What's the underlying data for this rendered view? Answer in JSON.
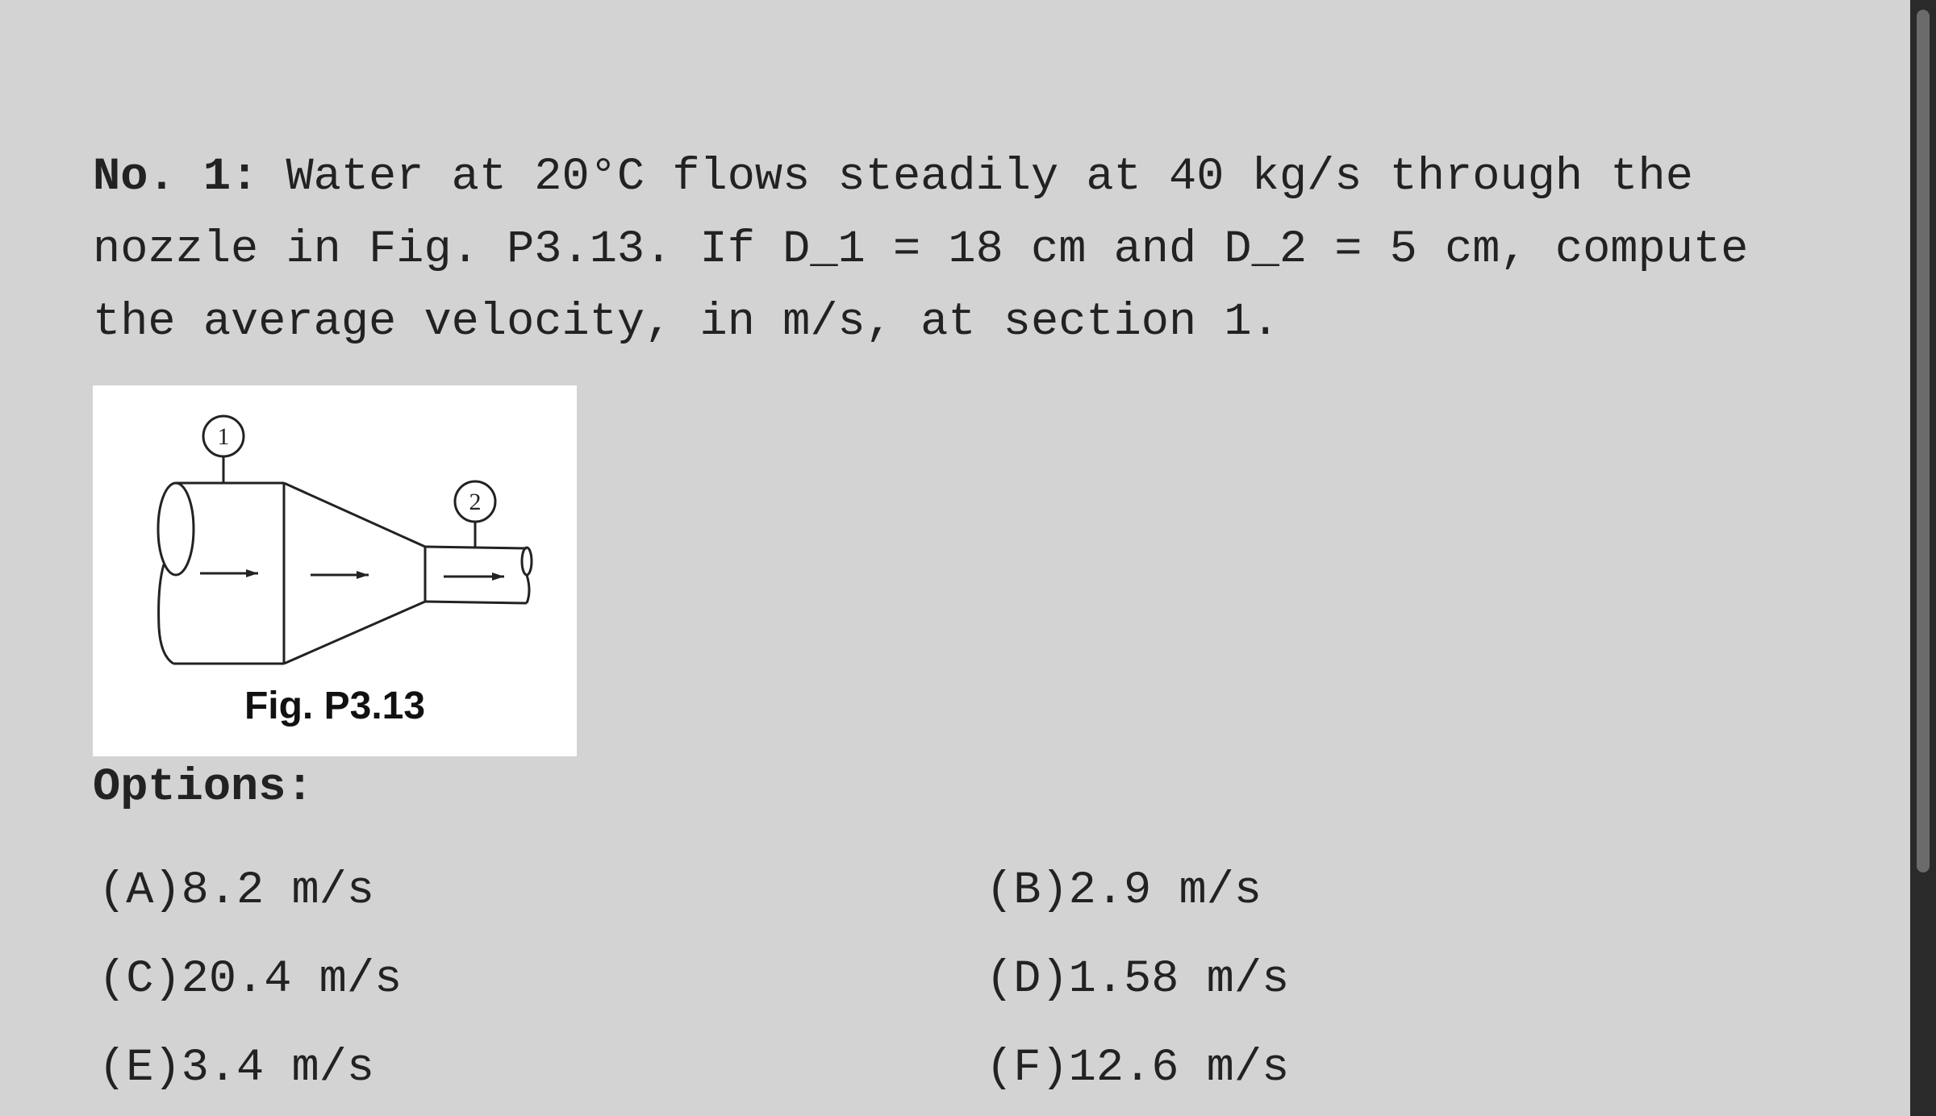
{
  "question": {
    "number_label": "No. 1:",
    "text": " Water at 20°C flows steadily at 40 kg/s through the nozzle in Fig. P3.13. If D_1 = 18 cm and D_2 = 5 cm, compute the average velocity, in m/s, at section 1."
  },
  "figure": {
    "caption": "Fig. P3.13",
    "section_1_label": "1",
    "section_2_label": "2"
  },
  "options_heading": "Options:",
  "options": [
    {
      "letter": "(A)",
      "text": "8.2 m/s"
    },
    {
      "letter": "(B)",
      "text": "2.9 m/s"
    },
    {
      "letter": "(C)",
      "text": "20.4 m/s"
    },
    {
      "letter": "(D)",
      "text": "1.58 m/s"
    },
    {
      "letter": "(E)",
      "text": "3.4 m/s"
    },
    {
      "letter": "(F)",
      "text": "12.6 m/s"
    }
  ]
}
